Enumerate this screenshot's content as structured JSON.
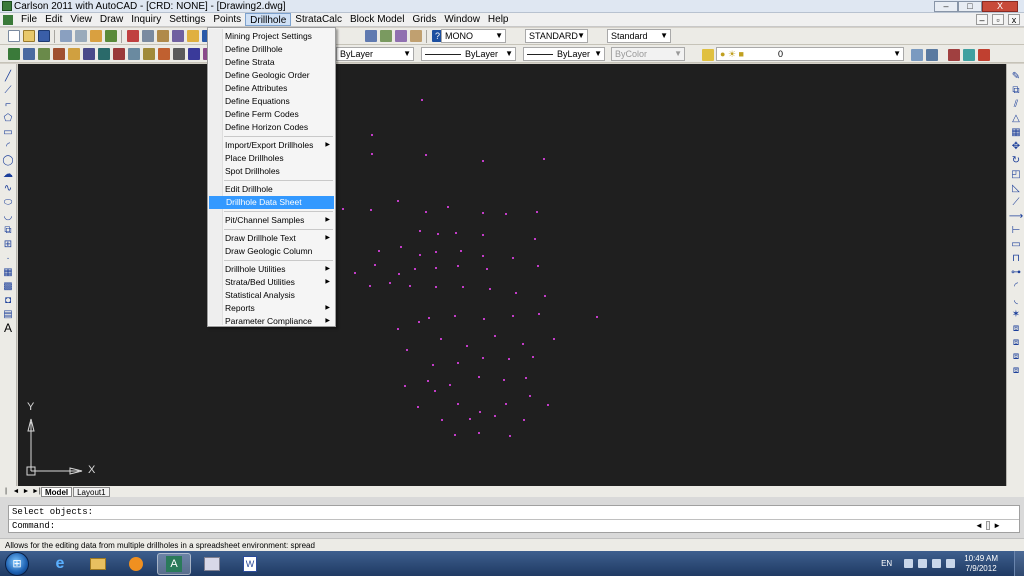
{
  "window": {
    "title": "Carlson 2011 with AutoCAD - [CRD: NONE] - [Drawing2.dwg]",
    "controls": {
      "minimize": "–",
      "maximize": "□",
      "close": "X"
    }
  },
  "menubar": {
    "items": [
      "File",
      "Edit",
      "View",
      "Draw",
      "Inquiry",
      "Settings",
      "Points",
      "Drillhole",
      "StrataCalc",
      "Block Model",
      "Grids",
      "Window",
      "Help"
    ],
    "active": "Drillhole",
    "mdi_controls": {
      "minimize": "–",
      "restore": "▫",
      "close": "x"
    }
  },
  "toolbar1": {
    "text_style": "MONO",
    "dim_style": "STANDARD",
    "table_style": "Standard"
  },
  "toolbar2": {
    "layer_color": "ByLayer",
    "linetype": "ByLayer",
    "lineweight": "ByLayer",
    "plot_style": "ByColor",
    "layer": "0"
  },
  "drillhole_menu": {
    "groups": [
      [
        "Mining Project Settings",
        "Define Drillhole",
        "Define Strata",
        "Define Geologic Order",
        "Define Attributes",
        "Define Equations",
        "Define Ferm Codes",
        "Define Horizon Codes"
      ],
      [
        "Import/Export Drillholes",
        "Place Drillholes",
        "Spot Drillholes"
      ],
      [
        "Edit Drillhole",
        "Drillhole Data Sheet"
      ],
      [
        "Pit/Channel Samples"
      ],
      [
        "Draw Drillhole Text",
        "Draw Geologic Column"
      ],
      [
        "Drillhole Utilities",
        "Strata/Bed Utilities",
        "Statistical Analysis",
        "Reports",
        "Parameter Compliance"
      ]
    ],
    "submenu_items": [
      "Import/Export Drillholes",
      "Pit/Channel Samples",
      "Draw Drillhole Text",
      "Drillhole Utilities",
      "Strata/Bed Utilities",
      "Reports",
      "Parameter Compliance"
    ],
    "highlighted": "Drillhole Data Sheet"
  },
  "canvas": {
    "background": "#1f1f1f",
    "point_color": "#c23cc8",
    "ucs": {
      "y_label": "Y",
      "x_label": "X"
    }
  },
  "layout_tabs": {
    "nav": [
      "|◄",
      "◄",
      "►",
      "►|"
    ],
    "tabs": [
      "Model",
      "Layout1"
    ],
    "active": "Model"
  },
  "command": {
    "lines": [
      "Select objects:",
      "Command:"
    ]
  },
  "statusbar": {
    "text": "Allows for the editing data from multiple drillholes in a spreadsheet environment: spread"
  },
  "taskbar": {
    "language": "EN",
    "time": "10:49 AM",
    "date": "7/9/2012"
  }
}
